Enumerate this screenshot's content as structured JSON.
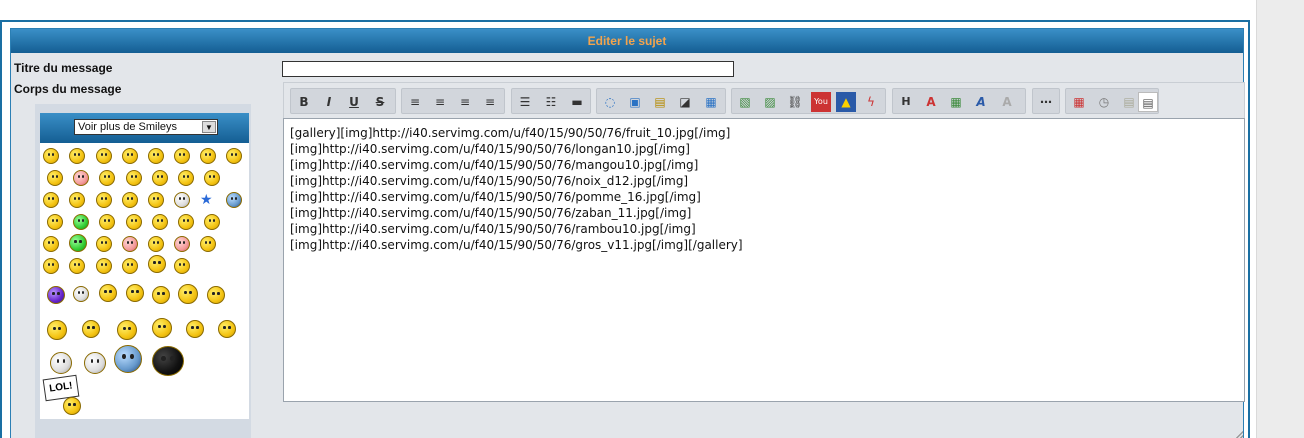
{
  "form": {
    "header_title": "Editer le sujet",
    "title_label": "Titre du message",
    "title_value": "",
    "body_label": "Corps du message"
  },
  "smileys": {
    "select_label": "Voir plus de Smileys",
    "items": [
      "smile",
      "grin",
      "wink",
      "sad",
      "shocked",
      "cool",
      "laugh",
      "tongue",
      "lol",
      "angry",
      "confused",
      "embarrassed",
      "evil",
      "neutral",
      "rolleyes",
      "twisted",
      "yellow-ball",
      "yellow-ball-2",
      "idea",
      "pac",
      "silent",
      "alien",
      "star",
      "sleepy",
      "love",
      "green",
      "spiral",
      "happy",
      "wink2",
      "sunny",
      "monster",
      "bunny",
      "pig",
      "jester",
      "sleep",
      "purple",
      "sun",
      "santa",
      "reindeer",
      "pharaoh",
      "gasp",
      "lion",
      "king",
      "angel",
      "book",
      "elephant",
      "flower",
      "afro",
      "lol-sign",
      "dance"
    ],
    "lol_sign_text": "LOL!"
  },
  "toolbar": {
    "bold": "B",
    "italic": "I",
    "underline": "U",
    "strike": "S",
    "heading": "H",
    "colors": {
      "accent": "#1a6fa3",
      "header_text": "#f3a44d"
    }
  },
  "body_text": "[gallery][img]http://i40.servimg.com/u/f40/15/90/50/76/fruit_10.jpg[/img]\n[img]http://i40.servimg.com/u/f40/15/90/50/76/longan10.jpg[/img]\n[img]http://i40.servimg.com/u/f40/15/90/50/76/mangou10.jpg[/img]\n[img]http://i40.servimg.com/u/f40/15/90/50/76/noix_d12.jpg[/img]\n[img]http://i40.servimg.com/u/f40/15/90/50/76/pomme_16.jpg[/img]\n[img]http://i40.servimg.com/u/f40/15/90/50/76/zaban_11.jpg[/img]\n[img]http://i40.servimg.com/u/f40/15/90/50/76/rambou10.jpg[/img]\n[img]http://i40.servimg.com/u/f40/15/90/50/76/gros_v11.jpg[/img][/gallery]"
}
